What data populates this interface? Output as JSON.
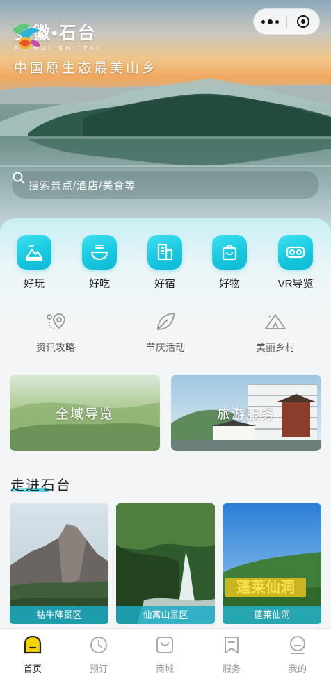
{
  "header": {
    "logo_title": "安徽•石台",
    "logo_subtitle": "AN HUI SHI TAI",
    "slogan": "中国原生态最美山乡"
  },
  "search": {
    "placeholder": "搜索景点/酒店/美食等",
    "icon": "search-icon"
  },
  "categories": [
    {
      "label": "好玩",
      "icon": "mountain-icon"
    },
    {
      "label": "好吃",
      "icon": "bowl-icon"
    },
    {
      "label": "好宿",
      "icon": "hotel-icon"
    },
    {
      "label": "好物",
      "icon": "shopping-bag-icon"
    },
    {
      "label": "VR导览",
      "icon": "vr-glasses-icon"
    }
  ],
  "subcategories": [
    {
      "label": "资讯攻略",
      "icon": "location-guide-icon"
    },
    {
      "label": "节庆活动",
      "icon": "leaf-icon"
    },
    {
      "label": "美丽乡村",
      "icon": "village-tent-icon"
    }
  ],
  "banners": [
    {
      "label": "全域导览"
    },
    {
      "label": "旅游服务"
    }
  ],
  "section": {
    "title": "走进石台"
  },
  "scenic_cards": [
    {
      "label": "牯牛降景区"
    },
    {
      "label": "仙寓山景区"
    },
    {
      "label": "蓬莱仙洞"
    }
  ],
  "card_sign_text": "蓬莱仙洞",
  "tabbar": [
    {
      "label": "首页",
      "icon": "home-icon",
      "active": true
    },
    {
      "label": "预订",
      "icon": "clock-icon",
      "active": false
    },
    {
      "label": "商城",
      "icon": "shop-icon",
      "active": false
    },
    {
      "label": "服务",
      "icon": "bookmark-icon",
      "active": false
    },
    {
      "label": "我的",
      "icon": "user-face-icon",
      "active": false
    }
  ],
  "colors": {
    "accent": "#1cc3dc",
    "active_tab": "#f5d200"
  }
}
